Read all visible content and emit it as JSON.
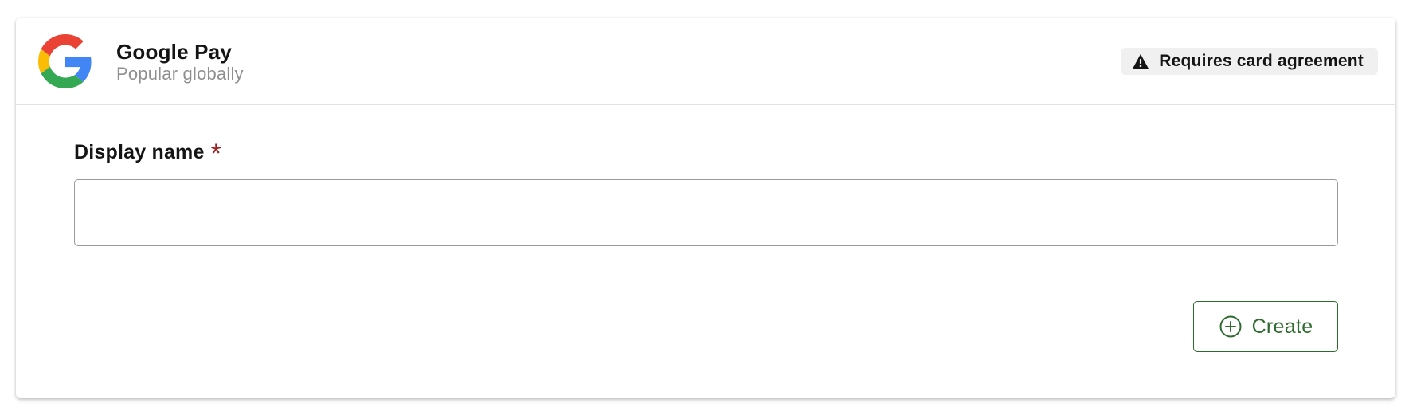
{
  "provider": {
    "name": "Google Pay",
    "subtitle": "Popular globally",
    "logo_icon": "google-g-logo",
    "logo_colors": {
      "red": "#db4437",
      "yellow": "#f4b400",
      "green": "#0f9d58",
      "blue": "#4285f4"
    }
  },
  "badge": {
    "icon": "warning-triangle-icon",
    "label": "Requires card agreement"
  },
  "form": {
    "display_name": {
      "label": "Display name",
      "required_mark": "*",
      "value": "",
      "placeholder": ""
    }
  },
  "actions": {
    "create": {
      "label": "Create",
      "icon": "plus-circle-icon",
      "color": "#2e6b2e"
    }
  }
}
